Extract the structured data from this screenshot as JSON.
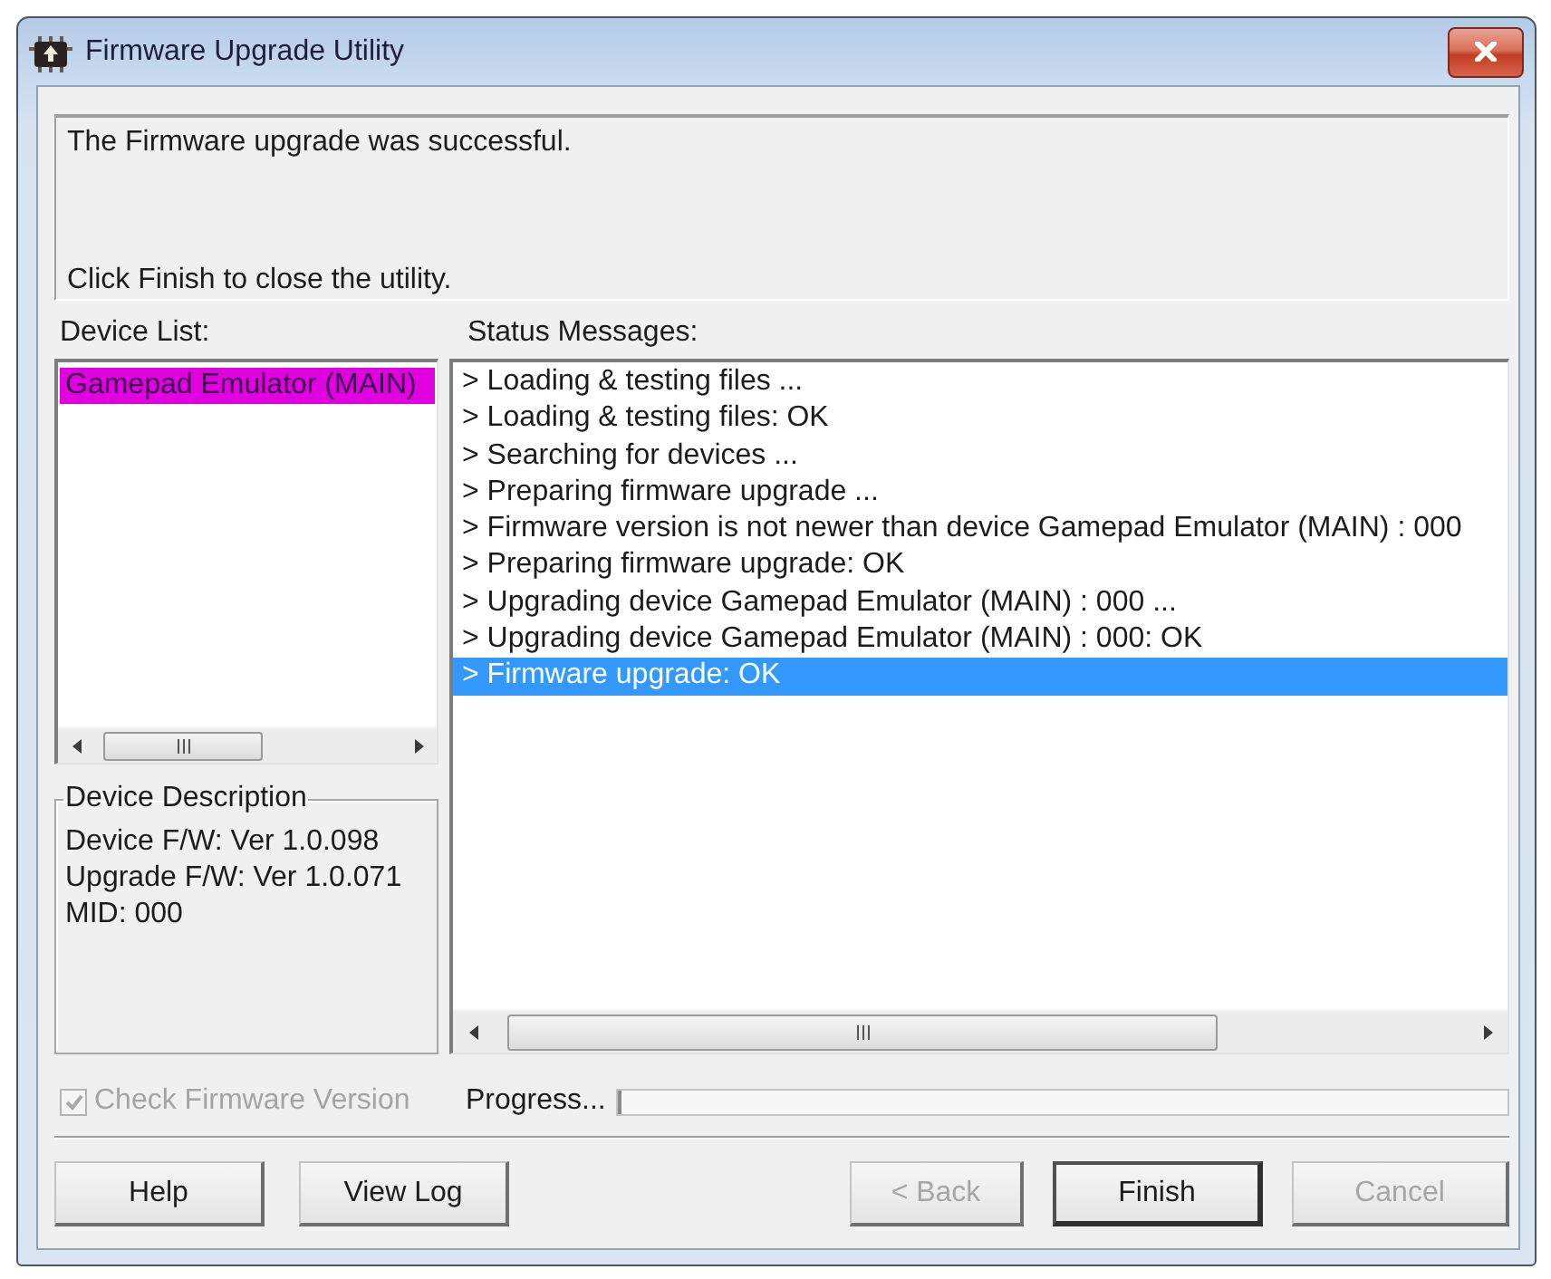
{
  "window": {
    "title": "Firmware Upgrade Utility"
  },
  "message": {
    "result": "The Firmware upgrade was successful.",
    "instruction": "Click Finish to close the utility."
  },
  "device_list": {
    "label": "Device List:",
    "items": [
      {
        "name": "Gamepad Emulator (MAIN)",
        "selected": true
      }
    ]
  },
  "device_description": {
    "title": "Device Description",
    "lines": [
      "Device F/W: Ver 1.0.098",
      "Upgrade F/W: Ver 1.0.071",
      "MID: 000"
    ]
  },
  "status_messages": {
    "label": "Status Messages:",
    "items": [
      {
        "text": "> Loading & testing files ...",
        "selected": false
      },
      {
        "text": "> Loading & testing files: OK",
        "selected": false
      },
      {
        "text": "> Searching for devices ...",
        "selected": false
      },
      {
        "text": "> Preparing firmware upgrade ...",
        "selected": false
      },
      {
        "text": "> Firmware version is not newer than device Gamepad Emulator (MAIN) : 000",
        "selected": false
      },
      {
        "text": "> Preparing firmware upgrade: OK",
        "selected": false
      },
      {
        "text": "> Upgrading device Gamepad Emulator (MAIN) : 000 ...",
        "selected": false
      },
      {
        "text": "> Upgrading device Gamepad Emulator (MAIN) : 000: OK",
        "selected": false
      },
      {
        "text": "> Firmware upgrade: OK",
        "selected": true
      }
    ]
  },
  "check_firmware_version": {
    "label": "Check Firmware Version",
    "checked": true,
    "disabled": true
  },
  "progress": {
    "label": "Progress...",
    "level": 0
  },
  "left_buttons": [
    {
      "label": "Help",
      "disabled": false
    },
    {
      "label": "View Log",
      "disabled": false
    }
  ],
  "wizard_buttons": [
    {
      "label": "< Back",
      "disabled": true,
      "default": false
    },
    {
      "label": "Finish",
      "disabled": false,
      "default": true
    },
    {
      "label": "Cancel",
      "disabled": true,
      "default": false
    }
  ]
}
